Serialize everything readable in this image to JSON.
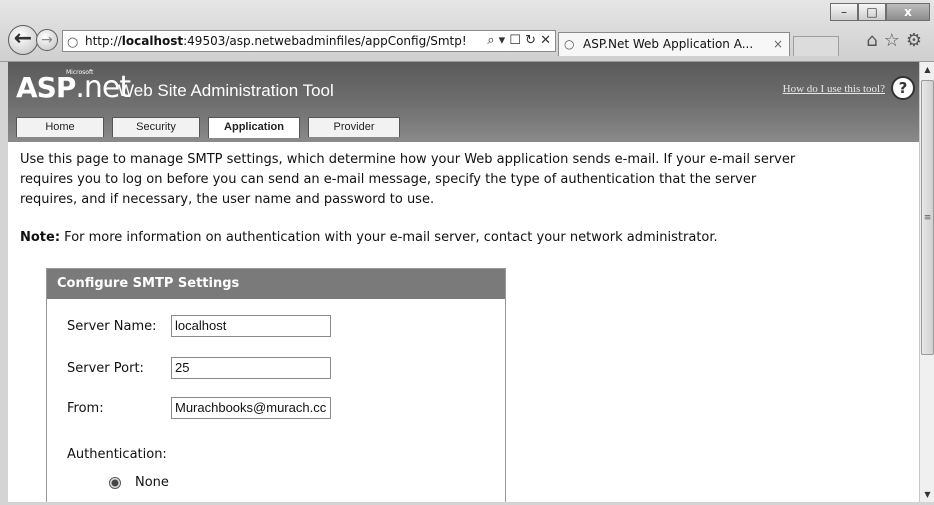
{
  "browser": {
    "window_buttons": [
      "–",
      "□",
      "x"
    ],
    "url_prefix": "http://",
    "url_host": "localhost",
    "url_rest": ":49503/asp.netwebadminfiles/appConfig/Smtp!",
    "url_tools": "⌕ ▾ ☐ ↻ ✕",
    "tab_title": "ASP.Net Web Application A...",
    "tab_close": "×",
    "right_icons": "⌂☆⚙"
  },
  "admin": {
    "logo_main": "ASP",
    "logo_net": ".net",
    "logo_ms": "Microsoft",
    "title": "Web Site Administration Tool",
    "help_link": "How do I use this tool?",
    "help_icon": "?",
    "tabs": [
      {
        "label": "Home"
      },
      {
        "label": "Security"
      },
      {
        "label": "Application"
      },
      {
        "label": "Provider"
      }
    ]
  },
  "content": {
    "intro": "Use this page to manage SMTP settings, which determine how your Web application sends e-mail. If your e-mail server requires you to log on before you can send an e-mail message, specify the type of authentication that the server requires, and if necessary, the user name and password to use.",
    "note_label": "Note:",
    "note_text": " For more information on authentication with your e-mail server, contact your network administrator."
  },
  "smtp": {
    "header": "Configure SMTP Settings",
    "server_name_label": "Server Name:",
    "server_name_value": "localhost",
    "server_port_label": "Server Port:",
    "server_port_value": "25",
    "from_label": "From:",
    "from_value": "Murachbooks@murach.cc",
    "auth_label": "Authentication:",
    "auth_none_label": "None"
  }
}
